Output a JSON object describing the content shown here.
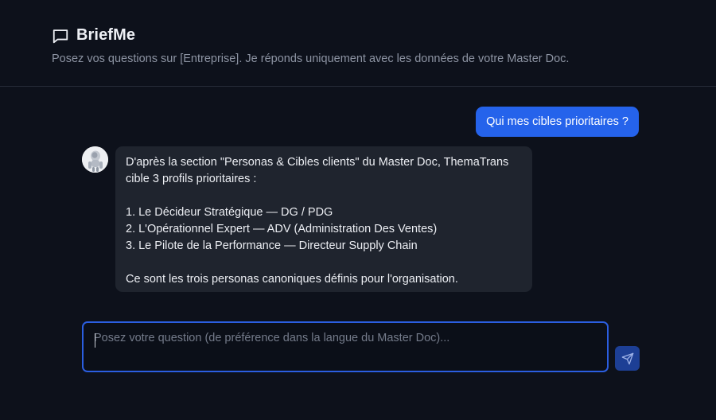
{
  "header": {
    "app_name": "BriefMe",
    "app_icon": "chat-bubble-icon",
    "subtitle": "Posez vos questions sur [Entreprise]. Je réponds uniquement avec les données de votre Master Doc."
  },
  "conversation": {
    "user_message": "Qui mes cibles prioritaires ?",
    "assistant_avatar_icon": "robot-avatar-icon",
    "assistant_message": {
      "intro_line_1": "D'après la section \"Personas & Cibles clients\" du Master Doc, ThemaTrans",
      "intro_line_2": "cible 3 profils prioritaires :",
      "items": [
        "1. Le Décideur Stratégique — DG / PDG",
        "2. L'Opérationnel Expert — ADV (Administration Des Ventes)",
        "3. Le Pilote de la Performance — Directeur Supply Chain"
      ],
      "closing": "Ce sont les trois personas canoniques définis pour l'organisation."
    }
  },
  "composer": {
    "placeholder": "Posez votre question (de préférence dans la langue du Master Doc)...",
    "value": "",
    "send_icon": "send-icon"
  },
  "colors": {
    "background": "#0d111b",
    "accent": "#2563eb",
    "assistant_bubble": "#1f242e",
    "send_button": "#1d3f95"
  }
}
